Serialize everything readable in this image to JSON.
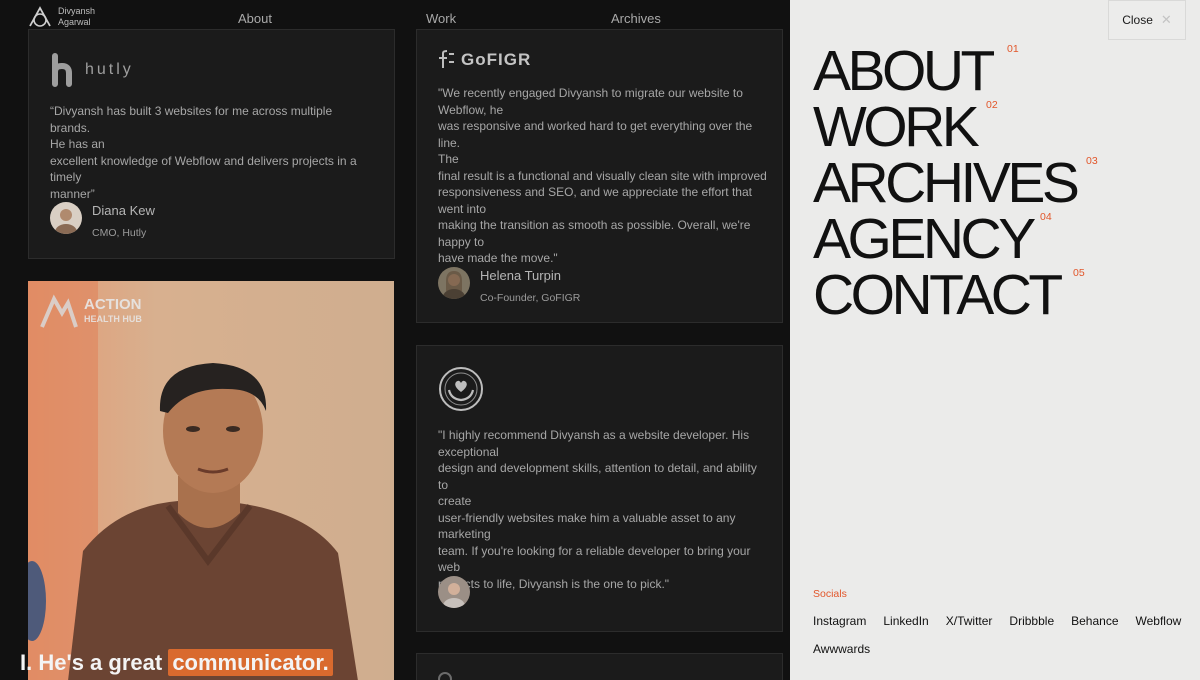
{
  "header": {
    "logo_line1": "Divyansh",
    "logo_line2": "Agarwal",
    "nav": [
      "About",
      "Work",
      "Archives"
    ]
  },
  "testimonials": [
    {
      "brand": "hutly",
      "quote": "“Divyansh has built 3 websites for me across multiple brands.\nHe has an\nexcellent knowledge of Webflow and delivers projects in a\ntimely\nmanner”",
      "name": "Diana Kew",
      "role": "CMO, Hutly"
    },
    {
      "brand": "GoFIGR",
      "quote": "\"We recently engaged Divyansh to migrate our website to\nWebflow, he\nwas responsive and worked hard to get everything over the line.\nThe\nfinal result is a functional and visually clean site with improved\nresponsiveness and SEO, and we appreciate the effort that\nwent into\nmaking the transition as smooth as possible. Overall, we're\nhappy to\nhave made the move.\"",
      "name": "Helena Turpin",
      "role": "Co-Founder, GoFIGR"
    },
    {
      "brand": "",
      "quote": "\"I highly recommend Divyansh as a website developer. His\nexceptional\ndesign and development skills, attention to detail, and ability to\ncreate\nuser-friendly websites make him a valuable asset to any\nmarketing\nteam. If you're looking for a reliable developer to bring your web\nprojects to life, Divyansh is the one to pick.\"",
      "name": "",
      "role": ""
    }
  ],
  "video": {
    "brand_line1": "ACTION",
    "brand_line2": "HEALTH HUB",
    "caption_prefix": "I. He's a great",
    "caption_highlight": "communicator."
  },
  "menu_panel": {
    "close_label": "Close",
    "close_icon": "close-icon",
    "items": [
      {
        "label": "ABOUT",
        "num": "01"
      },
      {
        "label": "WORK",
        "num": "02"
      },
      {
        "label": "ARCHIVES",
        "num": "03"
      },
      {
        "label": "AGENCY",
        "num": "04"
      },
      {
        "label": "CONTACT",
        "num": "05"
      }
    ],
    "socials_label": "Socials",
    "socials": [
      "Instagram",
      "LinkedIn",
      "X/Twitter",
      "Dribbble",
      "Behance",
      "Webflow",
      "Awwwards"
    ]
  },
  "colors": {
    "accent": "#e2562a",
    "panel_bg": "#ebebea",
    "dark_bg": "#111111",
    "card_bg": "#1b1b1b"
  }
}
